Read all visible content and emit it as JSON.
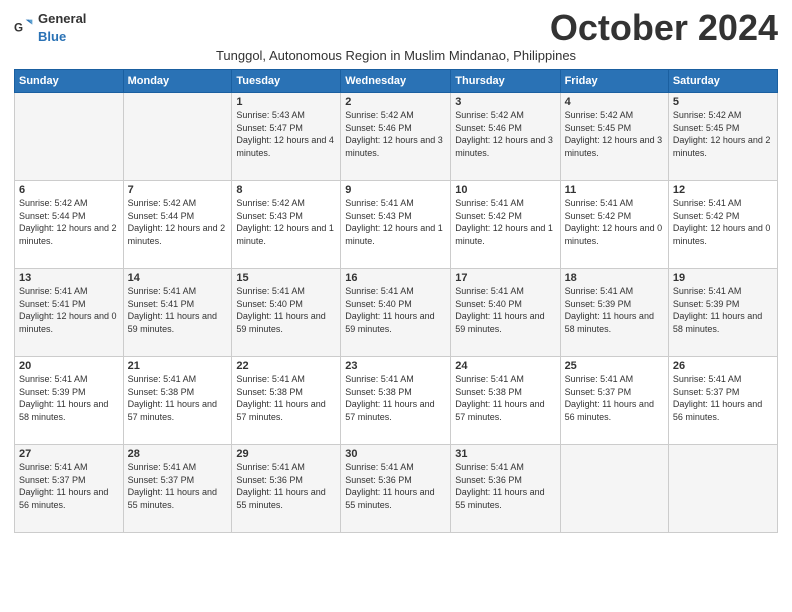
{
  "logo": {
    "general": "General",
    "blue": "Blue"
  },
  "header": {
    "month": "October 2024",
    "subtitle": "Tunggol, Autonomous Region in Muslim Mindanao, Philippines"
  },
  "days_of_week": [
    "Sunday",
    "Monday",
    "Tuesday",
    "Wednesday",
    "Thursday",
    "Friday",
    "Saturday"
  ],
  "weeks": [
    [
      {
        "day": "",
        "info": ""
      },
      {
        "day": "",
        "info": ""
      },
      {
        "day": "1",
        "info": "Sunrise: 5:43 AM\nSunset: 5:47 PM\nDaylight: 12 hours and 4 minutes."
      },
      {
        "day": "2",
        "info": "Sunrise: 5:42 AM\nSunset: 5:46 PM\nDaylight: 12 hours and 3 minutes."
      },
      {
        "day": "3",
        "info": "Sunrise: 5:42 AM\nSunset: 5:46 PM\nDaylight: 12 hours and 3 minutes."
      },
      {
        "day": "4",
        "info": "Sunrise: 5:42 AM\nSunset: 5:45 PM\nDaylight: 12 hours and 3 minutes."
      },
      {
        "day": "5",
        "info": "Sunrise: 5:42 AM\nSunset: 5:45 PM\nDaylight: 12 hours and 2 minutes."
      }
    ],
    [
      {
        "day": "6",
        "info": "Sunrise: 5:42 AM\nSunset: 5:44 PM\nDaylight: 12 hours and 2 minutes."
      },
      {
        "day": "7",
        "info": "Sunrise: 5:42 AM\nSunset: 5:44 PM\nDaylight: 12 hours and 2 minutes."
      },
      {
        "day": "8",
        "info": "Sunrise: 5:42 AM\nSunset: 5:43 PM\nDaylight: 12 hours and 1 minute."
      },
      {
        "day": "9",
        "info": "Sunrise: 5:41 AM\nSunset: 5:43 PM\nDaylight: 12 hours and 1 minute."
      },
      {
        "day": "10",
        "info": "Sunrise: 5:41 AM\nSunset: 5:42 PM\nDaylight: 12 hours and 1 minute."
      },
      {
        "day": "11",
        "info": "Sunrise: 5:41 AM\nSunset: 5:42 PM\nDaylight: 12 hours and 0 minutes."
      },
      {
        "day": "12",
        "info": "Sunrise: 5:41 AM\nSunset: 5:42 PM\nDaylight: 12 hours and 0 minutes."
      }
    ],
    [
      {
        "day": "13",
        "info": "Sunrise: 5:41 AM\nSunset: 5:41 PM\nDaylight: 12 hours and 0 minutes."
      },
      {
        "day": "14",
        "info": "Sunrise: 5:41 AM\nSunset: 5:41 PM\nDaylight: 11 hours and 59 minutes."
      },
      {
        "day": "15",
        "info": "Sunrise: 5:41 AM\nSunset: 5:40 PM\nDaylight: 11 hours and 59 minutes."
      },
      {
        "day": "16",
        "info": "Sunrise: 5:41 AM\nSunset: 5:40 PM\nDaylight: 11 hours and 59 minutes."
      },
      {
        "day": "17",
        "info": "Sunrise: 5:41 AM\nSunset: 5:40 PM\nDaylight: 11 hours and 59 minutes."
      },
      {
        "day": "18",
        "info": "Sunrise: 5:41 AM\nSunset: 5:39 PM\nDaylight: 11 hours and 58 minutes."
      },
      {
        "day": "19",
        "info": "Sunrise: 5:41 AM\nSunset: 5:39 PM\nDaylight: 11 hours and 58 minutes."
      }
    ],
    [
      {
        "day": "20",
        "info": "Sunrise: 5:41 AM\nSunset: 5:39 PM\nDaylight: 11 hours and 58 minutes."
      },
      {
        "day": "21",
        "info": "Sunrise: 5:41 AM\nSunset: 5:38 PM\nDaylight: 11 hours and 57 minutes."
      },
      {
        "day": "22",
        "info": "Sunrise: 5:41 AM\nSunset: 5:38 PM\nDaylight: 11 hours and 57 minutes."
      },
      {
        "day": "23",
        "info": "Sunrise: 5:41 AM\nSunset: 5:38 PM\nDaylight: 11 hours and 57 minutes."
      },
      {
        "day": "24",
        "info": "Sunrise: 5:41 AM\nSunset: 5:38 PM\nDaylight: 11 hours and 57 minutes."
      },
      {
        "day": "25",
        "info": "Sunrise: 5:41 AM\nSunset: 5:37 PM\nDaylight: 11 hours and 56 minutes."
      },
      {
        "day": "26",
        "info": "Sunrise: 5:41 AM\nSunset: 5:37 PM\nDaylight: 11 hours and 56 minutes."
      }
    ],
    [
      {
        "day": "27",
        "info": "Sunrise: 5:41 AM\nSunset: 5:37 PM\nDaylight: 11 hours and 56 minutes."
      },
      {
        "day": "28",
        "info": "Sunrise: 5:41 AM\nSunset: 5:37 PM\nDaylight: 11 hours and 55 minutes."
      },
      {
        "day": "29",
        "info": "Sunrise: 5:41 AM\nSunset: 5:36 PM\nDaylight: 11 hours and 55 minutes."
      },
      {
        "day": "30",
        "info": "Sunrise: 5:41 AM\nSunset: 5:36 PM\nDaylight: 11 hours and 55 minutes."
      },
      {
        "day": "31",
        "info": "Sunrise: 5:41 AM\nSunset: 5:36 PM\nDaylight: 11 hours and 55 minutes."
      },
      {
        "day": "",
        "info": ""
      },
      {
        "day": "",
        "info": ""
      }
    ]
  ]
}
